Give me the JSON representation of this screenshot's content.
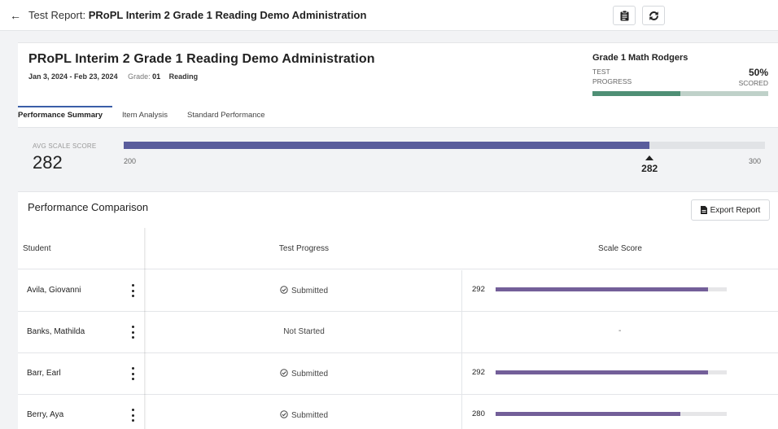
{
  "topbar": {
    "back_icon": "arrow-left-icon",
    "title_prefix": "Test Report: ",
    "title_bold": "PRoPL Interim 2 Grade 1 Reading Demo Administration",
    "clipboard_icon": "clipboard-icon",
    "refresh_icon": "refresh-icon"
  },
  "header": {
    "title": "PRoPL Interim 2 Grade 1 Reading Demo Administration",
    "dates": "Jan 3, 2024 - Feb 23, 2024",
    "grade_label": "Grade:",
    "grade_value": "01",
    "subject": "Reading",
    "class_name": "Grade 1 Math Rodgers",
    "progress_label_1": "TEST",
    "progress_label_2": "PROGRESS",
    "progress_pct": "50%",
    "progress_scored": "SCORED",
    "progress_fraction": 0.5,
    "accent_color": "#4f8f75"
  },
  "tabs": [
    {
      "label": "Performance Summary",
      "active": true
    },
    {
      "label": "Item Analysis",
      "active": false
    },
    {
      "label": "Standard Performance",
      "active": false
    }
  ],
  "avg": {
    "label": "AVG SCALE SCORE",
    "value": "282",
    "min": "200",
    "max": "300",
    "min_num": 200,
    "max_num": 300,
    "score_num": 282,
    "bar_color": "#5a5d9c"
  },
  "comparison": {
    "title": "Performance Comparison",
    "export_label": "Export Report",
    "export_icon": "file-icon",
    "columns": [
      "Student",
      "Test Progress",
      "Scale Score"
    ],
    "score_min": 200,
    "score_max": 300,
    "rows": [
      {
        "name": "Avila, Giovanni",
        "status": "Submitted",
        "submitted": true,
        "score": "292",
        "score_num": 292
      },
      {
        "name": "Banks, Mathilda",
        "status": "Not Started",
        "submitted": false,
        "score": "-",
        "score_num": null
      },
      {
        "name": "Barr, Earl",
        "status": "Submitted",
        "submitted": true,
        "score": "292",
        "score_num": 292
      },
      {
        "name": "Berry, Aya",
        "status": "Submitted",
        "submitted": true,
        "score": "280",
        "score_num": 280
      }
    ]
  }
}
